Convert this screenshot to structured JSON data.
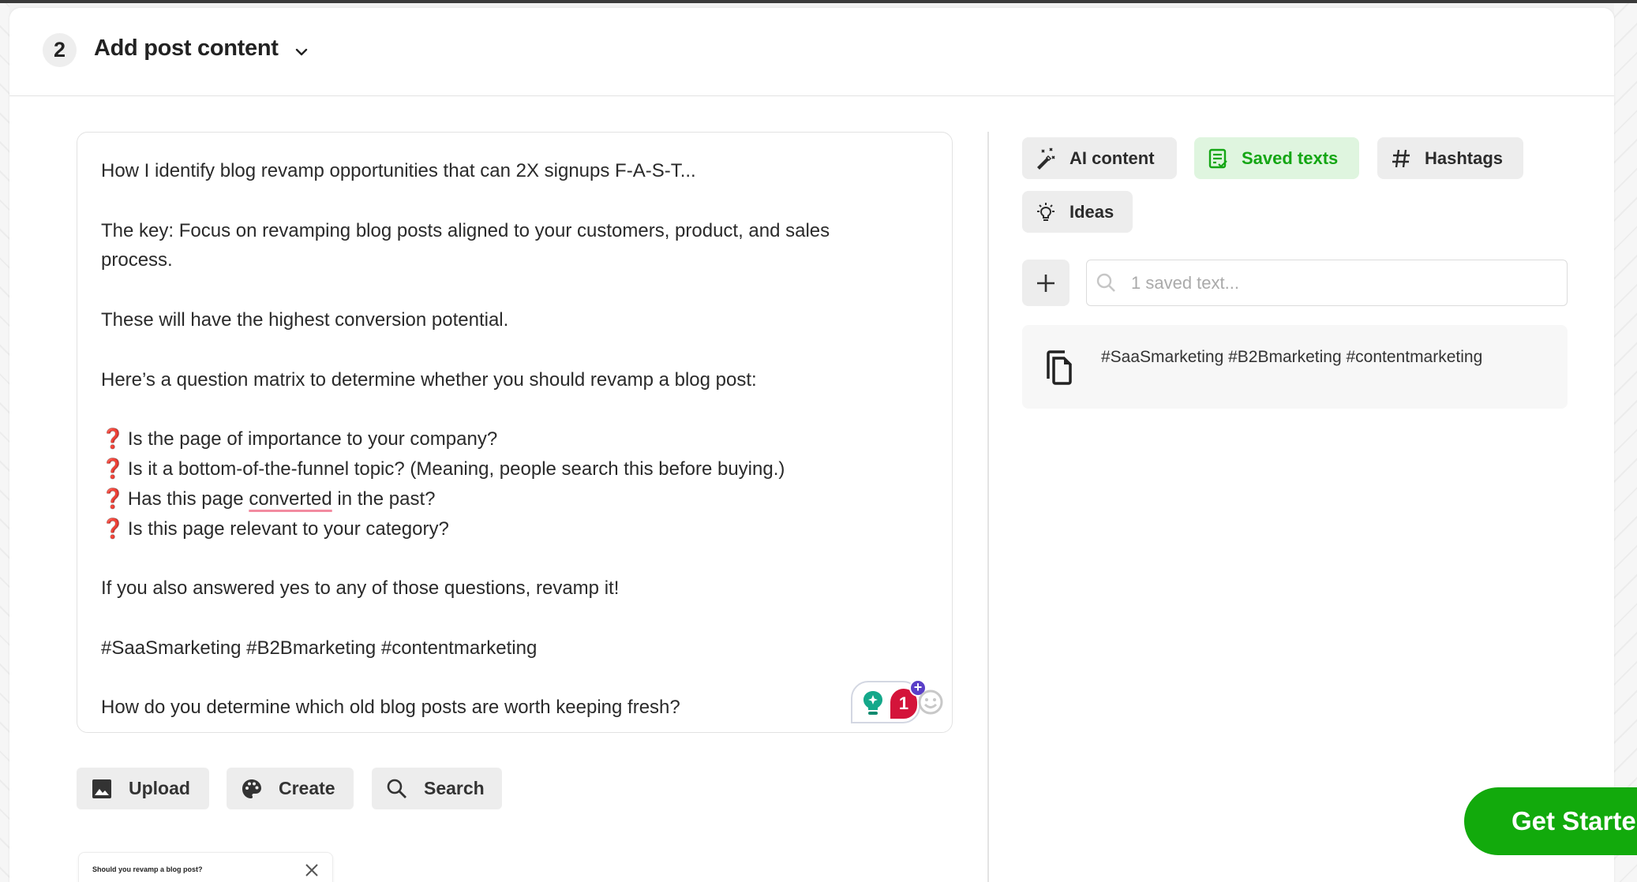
{
  "header": {
    "step_number": "2",
    "title": "Add post content"
  },
  "editor": {
    "lines": [
      {
        "text": "How I identify blog revamp opportunities that can 2X signups F-A-S-T...",
        "type": "text"
      },
      {
        "text": "",
        "type": "blank"
      },
      {
        "text": "The key: Focus on revamping blog posts aligned to your customers, product, and sales",
        "type": "text"
      },
      {
        "text": "process.",
        "type": "text"
      },
      {
        "text": "",
        "type": "blank"
      },
      {
        "text": "These will have the highest conversion potential.",
        "type": "text"
      },
      {
        "text": "",
        "type": "blank"
      },
      {
        "text": "Here’s a question matrix to determine whether you should revamp a blog post:",
        "type": "text"
      },
      {
        "text": "",
        "type": "blank"
      },
      {
        "text": "Is the page of importance to your company?",
        "type": "question"
      },
      {
        "text": "Is it a bottom-of-the-funnel topic? (Meaning, people search this before buying.)",
        "type": "question"
      },
      {
        "text": "Has this page converted in the past?",
        "type": "question",
        "spellcheck_word": "converted"
      },
      {
        "text": "Is this page relevant to your category?",
        "type": "question"
      },
      {
        "text": "",
        "type": "blank"
      },
      {
        "text": "If you also answered yes to any of those questions, revamp it!",
        "type": "text"
      },
      {
        "text": "",
        "type": "blank"
      },
      {
        "text": "#SaaSmarketing #B2Bmarketing #contentmarketing",
        "type": "text"
      },
      {
        "text": "",
        "type": "blank"
      },
      {
        "text": "How do you determine which old blog posts are worth keeping fresh?",
        "type": "text"
      }
    ],
    "question_emoji": "❓",
    "extension_badge_count": "1",
    "extension_plus": "+"
  },
  "tools": {
    "tabs": [
      {
        "label": "AI content",
        "icon": "magic-wand-icon",
        "active": false
      },
      {
        "label": "Saved texts",
        "icon": "saved-text-icon",
        "active": true
      },
      {
        "label": "Hashtags",
        "icon": "hash-icon",
        "active": false
      },
      {
        "label": "Ideas",
        "icon": "lightbulb-icon",
        "active": false
      }
    ],
    "search_placeholder": "1 saved text...",
    "search_value": "",
    "saved_items": [
      {
        "text": "#SaaSmarketing #B2Bmarketing #contentmarketing"
      }
    ]
  },
  "media": {
    "upload_label": "Upload",
    "create_label": "Create",
    "search_label": "Search"
  },
  "attachment": {
    "title": "Should you revamp a blog post?"
  },
  "cta": {
    "label": "Get Started"
  },
  "colors": {
    "accent_green": "#12aa0c",
    "active_tab_bg": "#dff5df",
    "active_tab_text": "#14a614",
    "badge_red": "#d4143a"
  }
}
